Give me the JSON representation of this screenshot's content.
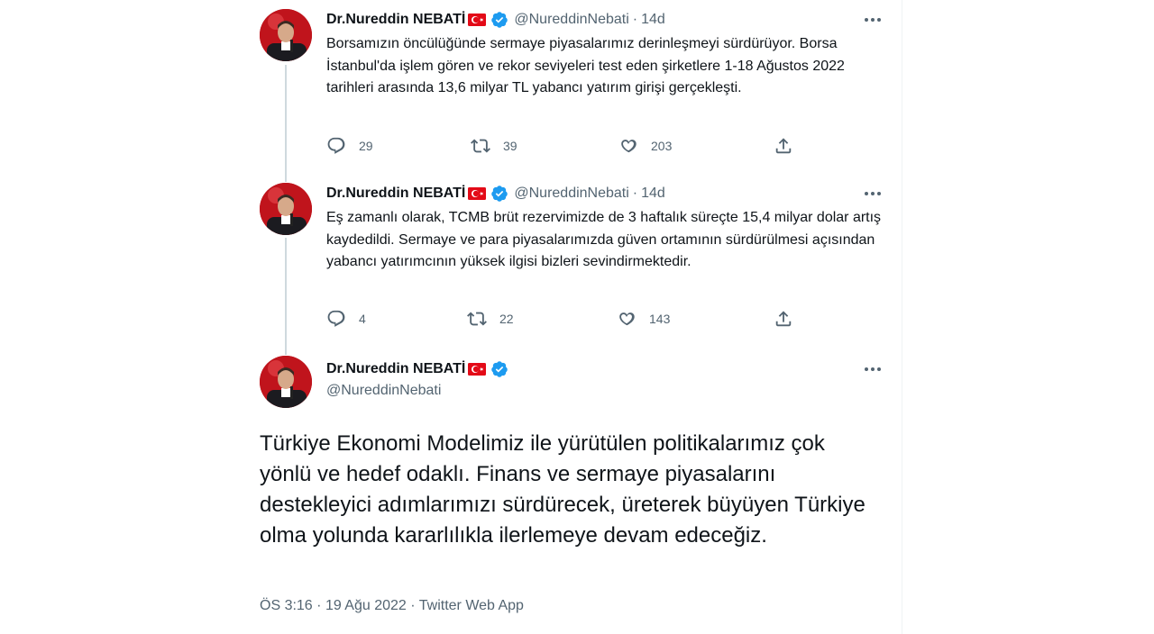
{
  "author": {
    "name": "Dr.Nureddin NEBATİ",
    "handle": "@NureddinNebati"
  },
  "thread": [
    {
      "time": "14d",
      "text": "Borsamızın öncülüğünde sermaye piyasalarımız  derinleşmeyi sürdürüyor. Borsa İstanbul'da işlem gören ve rekor seviyeleri test eden şirketlere 1-18 Ağustos 2022 tarihleri arasında 13,6 milyar TL yabancı yatırım girişi gerçekleşti.",
      "replies": "29",
      "retweets": "39",
      "likes": "203"
    },
    {
      "time": "14d",
      "text": "Eş zamanlı olarak, TCMB brüt rezervimizde de 3 haftalık süreçte 15,4 milyar dolar artış kaydedildi. Sermaye ve para piyasalarımızda güven ortamının sürdürülmesi açısından yabancı yatırımcının yüksek ilgisi bizleri sevindirmektedir.",
      "replies": "4",
      "retweets": "22",
      "likes": "143"
    }
  ],
  "main_tweet": {
    "text": "Türkiye Ekonomi Modelimiz ile yürütülen politikalarımız çok yönlü ve hedef odaklı. Finans ve sermaye piyasalarını destekleyici adımlarımızı sürdürecek, üreterek büyüyen Türkiye olma yolunda kararlılıkla ilerlemeye devam edeceğiz.",
    "time": "ÖS 3:16",
    "date": "19 Ağu 2022",
    "source": "Twitter Web App",
    "separator": "·"
  },
  "colors": {
    "text": "#0f1419",
    "secondary": "#536471",
    "verified": "#1d9bf0",
    "flag": "#e30a17",
    "thread_line": "#cfd9de"
  },
  "icons": [
    "more-icon",
    "reply-icon",
    "retweet-icon",
    "like-icon",
    "share-icon",
    "verified-icon",
    "turkey-flag-icon"
  ]
}
